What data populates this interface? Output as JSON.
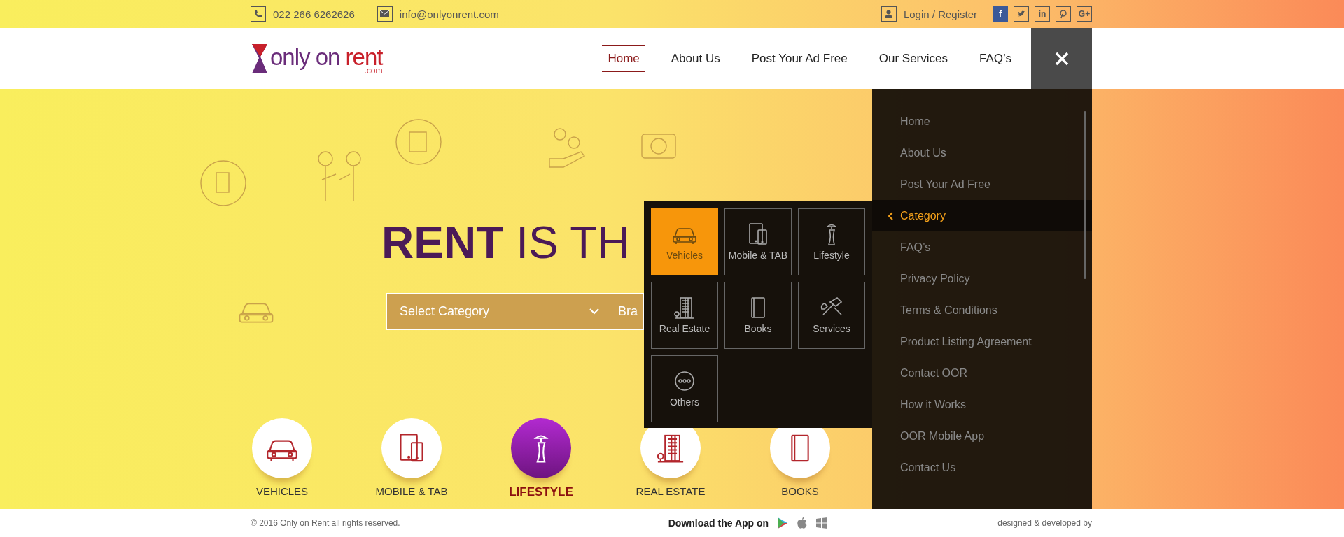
{
  "topbar": {
    "phone": "022 266 6262626",
    "email": "info@onlyonrent.com",
    "login": "Login / Register",
    "social": [
      {
        "kind": "letter",
        "label": "f",
        "filled": true
      },
      {
        "kind": "bird",
        "filled": false
      },
      {
        "kind": "letter",
        "label": "in",
        "filled": false
      },
      {
        "kind": "pin",
        "filled": false
      },
      {
        "kind": "letter",
        "label": "G+",
        "filled": false
      }
    ]
  },
  "logo": {
    "main": "only on ",
    "accent": "rent",
    "suffix": ".com"
  },
  "nav": {
    "items": [
      {
        "label": "Home",
        "selected": true
      },
      {
        "label": "About Us",
        "selected": false
      },
      {
        "label": "Post Your Ad Free",
        "selected": false
      },
      {
        "label": "Our Services",
        "selected": false
      },
      {
        "label": "FAQ’s",
        "selected": false
      }
    ]
  },
  "hero": {
    "heading_bold": "RENT",
    "heading_rest": "IS TH",
    "select": "Select Category",
    "brand_placeholder": "Bra",
    "categories": [
      {
        "kind": "car",
        "label": "VEHICLES",
        "selected": false
      },
      {
        "kind": "tablet",
        "label": "MOBILE & TAB",
        "selected": false
      },
      {
        "kind": "dress",
        "label": "LIFESTYLE",
        "selected": true
      },
      {
        "kind": "building",
        "label": "REAL ESTATE",
        "selected": false
      },
      {
        "kind": "book",
        "label": "BOOKS",
        "selected": false
      }
    ]
  },
  "menu": {
    "items": [
      {
        "label": "Home",
        "selected": false
      },
      {
        "label": "About Us",
        "selected": false
      },
      {
        "label": "Post Your Ad Free",
        "selected": false
      },
      {
        "label": "Category",
        "selected": true
      },
      {
        "label": "FAQ’s",
        "selected": false
      },
      {
        "label": "Privacy  Policy",
        "selected": false
      },
      {
        "label": "Terms & Conditions",
        "selected": false
      },
      {
        "label": "Product Listing Agreement",
        "selected": false
      },
      {
        "label": "Contact OOR",
        "selected": false
      },
      {
        "label": "How it Works",
        "selected": false
      },
      {
        "label": "OOR Mobile App",
        "selected": false
      },
      {
        "label": "Contact Us",
        "selected": false
      }
    ]
  },
  "submenu": {
    "items": [
      {
        "kind": "car",
        "label": "Vehicles",
        "selected": true
      },
      {
        "kind": "tablet",
        "label": "Mobile & TAB",
        "selected": false
      },
      {
        "kind": "dress",
        "label": "Lifestyle",
        "selected": false
      },
      {
        "kind": "building",
        "label": "Real Estate",
        "selected": false
      },
      {
        "kind": "book",
        "label": "Books",
        "selected": false
      },
      {
        "kind": "tools",
        "label": "Services",
        "selected": false
      },
      {
        "kind": "dots",
        "label": "Others",
        "selected": false
      }
    ]
  },
  "footer": {
    "copyright": "© 2016 Only on Rent all rights reserved.",
    "download": "Download the App on",
    "credit": "designed  & developed by"
  }
}
